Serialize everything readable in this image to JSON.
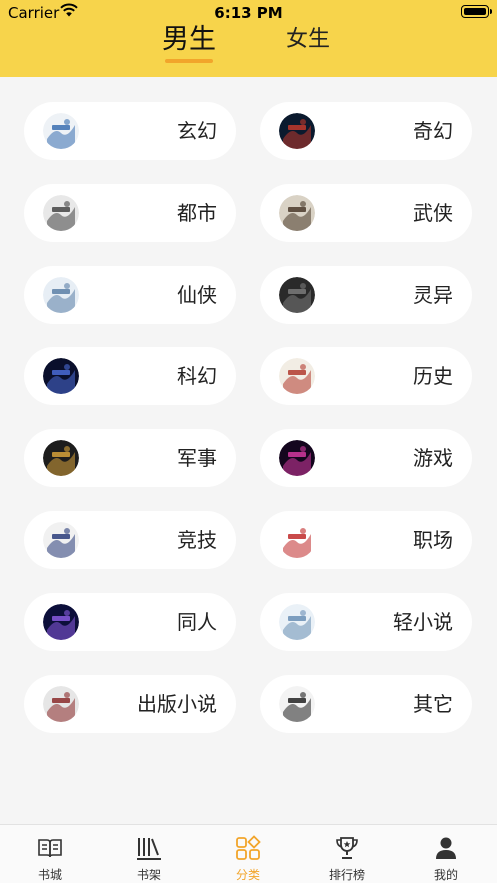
{
  "status_bar": {
    "carrier": "Carrier",
    "time": "6:13 PM"
  },
  "gender_tabs": [
    {
      "label": "男生",
      "active": true
    },
    {
      "label": "女生",
      "active": false
    }
  ],
  "categories": [
    {
      "label": "玄幻",
      "cover_colors": [
        "#eef2f6",
        "#3a6fb0"
      ]
    },
    {
      "label": "奇幻",
      "cover_colors": [
        "#0b1a2e",
        "#c0392b"
      ]
    },
    {
      "label": "都市",
      "cover_colors": [
        "#e8e8e8",
        "#444444"
      ]
    },
    {
      "label": "武侠",
      "cover_colors": [
        "#d9d2c5",
        "#4a3a2a"
      ]
    },
    {
      "label": "仙侠",
      "cover_colors": [
        "#e7eef5",
        "#5b7fa6"
      ]
    },
    {
      "label": "灵异",
      "cover_colors": [
        "#2a2a2a",
        "#7a7a7a"
      ]
    },
    {
      "label": "科幻",
      "cover_colors": [
        "#0a0f2c",
        "#4a6bd6"
      ]
    },
    {
      "label": "历史",
      "cover_colors": [
        "#f2ede4",
        "#b23a2e"
      ]
    },
    {
      "label": "军事",
      "cover_colors": [
        "#1d1d1d",
        "#d6a13a"
      ]
    },
    {
      "label": "游戏",
      "cover_colors": [
        "#14061e",
        "#d23aa0"
      ]
    },
    {
      "label": "竞技",
      "cover_colors": [
        "#f1f1f1",
        "#2a3c7a"
      ]
    },
    {
      "label": "职场",
      "cover_colors": [
        "#ffffff",
        "#c02a2a"
      ]
    },
    {
      "label": "同人",
      "cover_colors": [
        "#0c0f3a",
        "#8a5be0"
      ]
    },
    {
      "label": "轻小说",
      "cover_colors": [
        "#eaf1f7",
        "#6a8fb5"
      ]
    },
    {
      "label": "出版小说",
      "cover_colors": [
        "#e6e6e6",
        "#8a2a2a"
      ]
    },
    {
      "label": "其它",
      "cover_colors": [
        "#f3f3f3",
        "#222222"
      ]
    }
  ],
  "tab_bar": [
    {
      "label": "书城",
      "icon": "book-open-icon",
      "active": false
    },
    {
      "label": "书架",
      "icon": "bookshelf-icon",
      "active": false
    },
    {
      "label": "分类",
      "icon": "category-grid-icon",
      "active": true
    },
    {
      "label": "排行榜",
      "icon": "trophy-icon",
      "active": false
    },
    {
      "label": "我的",
      "icon": "person-icon",
      "active": false
    }
  ],
  "colors": {
    "header_bg": "#f7d44b",
    "accent": "#f2a52b",
    "page_bg": "#f5f5f5"
  }
}
